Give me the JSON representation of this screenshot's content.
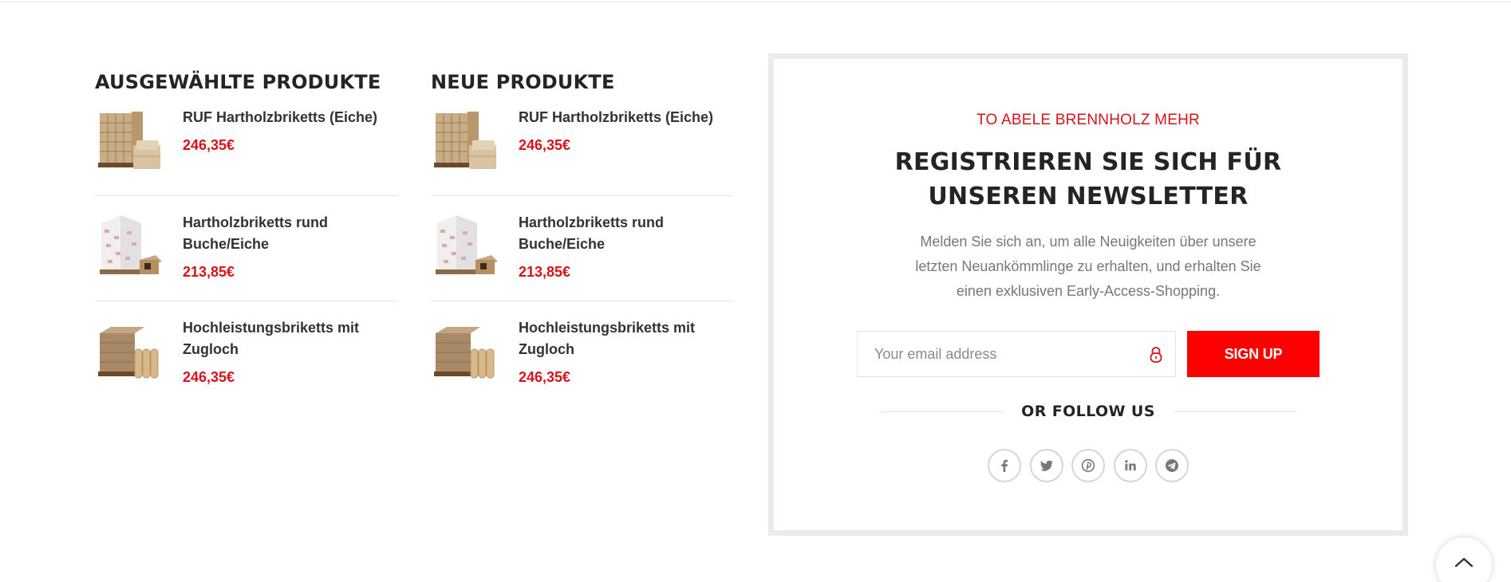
{
  "featured": {
    "title": "AUSGEWÄHLTE PRODUKTE",
    "products": [
      {
        "name": "RUF Hartholzbriketts (Eiche)",
        "price": "246,35€",
        "image": "briquette-pallet"
      },
      {
        "name": "Hartholzbriketts rund Buche/Eiche",
        "price": "213,85€",
        "image": "wrapped-pallet"
      },
      {
        "name": "Hochleistungsbriketts mit Zugloch",
        "price": "246,35€",
        "image": "cylinder-briquettes"
      }
    ]
  },
  "newest": {
    "title": "NEUE PRODUKTE",
    "products": [
      {
        "name": "RUF Hartholzbriketts (Eiche)",
        "price": "246,35€",
        "image": "briquette-pallet"
      },
      {
        "name": "Hartholzbriketts rund Buche/Eiche",
        "price": "213,85€",
        "image": "wrapped-pallet"
      },
      {
        "name": "Hochleistungsbriketts mit Zugloch",
        "price": "246,35€",
        "image": "cylinder-briquettes"
      }
    ]
  },
  "newsletter": {
    "subtitle": "TO ABELE BRENNHOLZ MEHR",
    "title": "REGISTRIEREN SIE SICH FÜR UNSEREN NEWSLETTER",
    "description": "Melden Sie sich an, um alle Neuigkeiten über unsere letzten Neuankömmlinge zu erhalten, und erhalten Sie einen exklusiven Early-Access-Shopping.",
    "email_placeholder": "Your email address",
    "email_value": "",
    "signup_label": "SIGN UP",
    "follow_label": "OR FOLLOW US",
    "socials": [
      "facebook-icon",
      "twitter-icon",
      "pinterest-icon",
      "linkedin-icon",
      "telegram-icon"
    ]
  },
  "colors": {
    "accent": "#d7141b",
    "button": "#ff0000",
    "text": "#242424",
    "muted": "#777777",
    "border": "#ebebeb"
  },
  "scroll_top_icon": "chevron-up-icon"
}
